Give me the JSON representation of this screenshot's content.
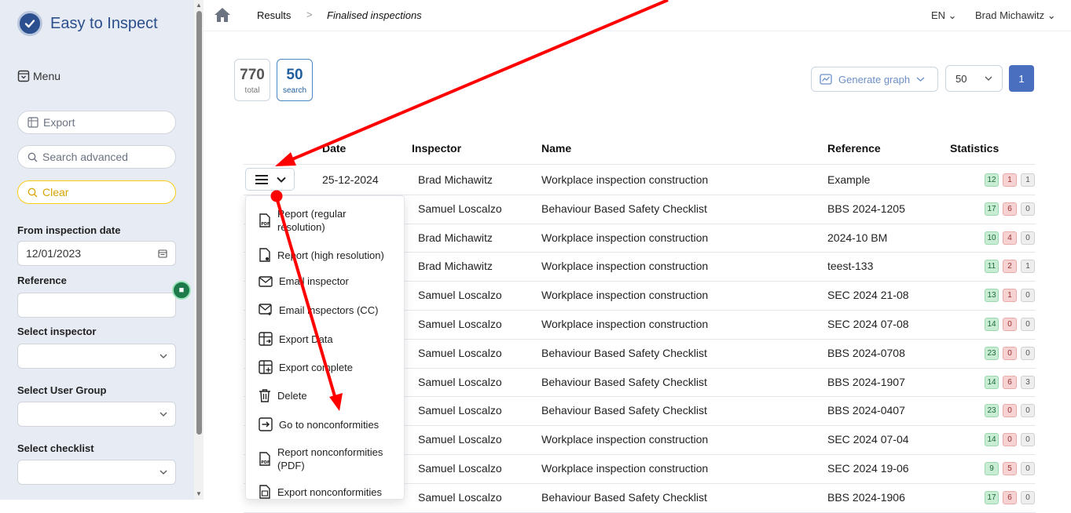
{
  "app": {
    "name": "Easy to Inspect"
  },
  "sidebar": {
    "menu_label": "Menu",
    "export_label": "Export",
    "search_placeholder": "Search advanced",
    "clear_label": "Clear",
    "from_date_label": "From inspection date",
    "from_date_value": "12/01/2023",
    "reference_label": "Reference",
    "reference_value": "",
    "inspector_label": "Select inspector",
    "usergroup_label": "Select User Group",
    "checklist_label": "Select checklist"
  },
  "breadcrumb": {
    "results": "Results",
    "separator": ">",
    "current": "Finalised inspections"
  },
  "header": {
    "language": "EN",
    "user": "Brad Michawitz"
  },
  "counts": {
    "total": "770",
    "total_label": "total",
    "search": "50",
    "search_label": "search"
  },
  "toolbar": {
    "graph_label": "Generate graph",
    "page_size": "50",
    "page": "1"
  },
  "table": {
    "headers": {
      "date": "Date",
      "inspector": "Inspector",
      "name": "Name",
      "reference": "Reference",
      "statistics": "Statistics"
    },
    "rows": [
      {
        "date": "25-12-2024",
        "inspector": "Brad Michawitz",
        "name": "Workplace inspection construction",
        "reference": "Example",
        "s1": "12",
        "s2": "1",
        "s3": "1"
      },
      {
        "date": "",
        "inspector": "Samuel Loscalzo",
        "name": "Behaviour Based Safety Checklist",
        "reference": "BBS 2024-1205",
        "s1": "17",
        "s2": "6",
        "s3": "0"
      },
      {
        "date": "",
        "inspector": "Brad Michawitz",
        "name": "Workplace inspection construction",
        "reference": "2024-10 BM",
        "s1": "10",
        "s2": "4",
        "s3": "0"
      },
      {
        "date": "",
        "inspector": "Brad Michawitz",
        "name": "Workplace inspection construction",
        "reference": "teest-133",
        "s1": "11",
        "s2": "2",
        "s3": "1"
      },
      {
        "date": "",
        "inspector": "Samuel Loscalzo",
        "name": "Workplace inspection construction",
        "reference": "SEC 2024 21-08",
        "s1": "13",
        "s2": "1",
        "s3": "0"
      },
      {
        "date": "",
        "inspector": "Samuel Loscalzo",
        "name": "Workplace inspection construction",
        "reference": "SEC 2024 07-08",
        "s1": "14",
        "s2": "0",
        "s3": "0"
      },
      {
        "date": "",
        "inspector": "Samuel Loscalzo",
        "name": "Behaviour Based Safety Checklist",
        "reference": "BBS 2024-0708",
        "s1": "23",
        "s2": "0",
        "s3": "0"
      },
      {
        "date": "",
        "inspector": "Samuel Loscalzo",
        "name": "Behaviour Based Safety Checklist",
        "reference": "BBS 2024-1907",
        "s1": "14",
        "s2": "6",
        "s3": "3"
      },
      {
        "date": "",
        "inspector": "Samuel Loscalzo",
        "name": "Behaviour Based Safety Checklist",
        "reference": "BBS 2024-0407",
        "s1": "23",
        "s2": "0",
        "s3": "0"
      },
      {
        "date": "",
        "inspector": "Samuel Loscalzo",
        "name": "Workplace inspection construction",
        "reference": "SEC 2024 07-04",
        "s1": "14",
        "s2": "0",
        "s3": "0"
      },
      {
        "date": "",
        "inspector": "Samuel Loscalzo",
        "name": "Workplace inspection construction",
        "reference": "SEC 2024 19-06",
        "s1": "9",
        "s2": "5",
        "s3": "0"
      },
      {
        "date": "",
        "inspector": "Samuel Loscalzo",
        "name": "Behaviour Based Safety Checklist",
        "reference": "BBS 2024-1906",
        "s1": "17",
        "s2": "6",
        "s3": "0"
      }
    ]
  },
  "row_menu": {
    "items": [
      {
        "label": "Report (regular resolution)",
        "icon": "pdf-icon"
      },
      {
        "label": "Report (high resolution)",
        "icon": "document-icon"
      },
      {
        "label": "Email inspector",
        "icon": "mail-icon"
      },
      {
        "label": "Email inspectors (CC)",
        "icon": "mail-plus-icon"
      },
      {
        "label": "Export Data",
        "icon": "export-table-icon"
      },
      {
        "label": "Export complete",
        "icon": "export-table-plus-icon"
      },
      {
        "label": "Delete",
        "icon": "trash-icon"
      },
      {
        "label": "Go to nonconformities",
        "icon": "arrow-box-icon"
      },
      {
        "label": "Report nonconformities (PDF)",
        "icon": "pdf-icon"
      },
      {
        "label": "Export nonconformities",
        "icon": "spreadsheet-icon"
      }
    ]
  },
  "colors": {
    "brand": "#2b4f8c",
    "accent": "#4a6fbf",
    "annotation": "#ff0000",
    "sidebar_bg": "#e7ebf4"
  }
}
